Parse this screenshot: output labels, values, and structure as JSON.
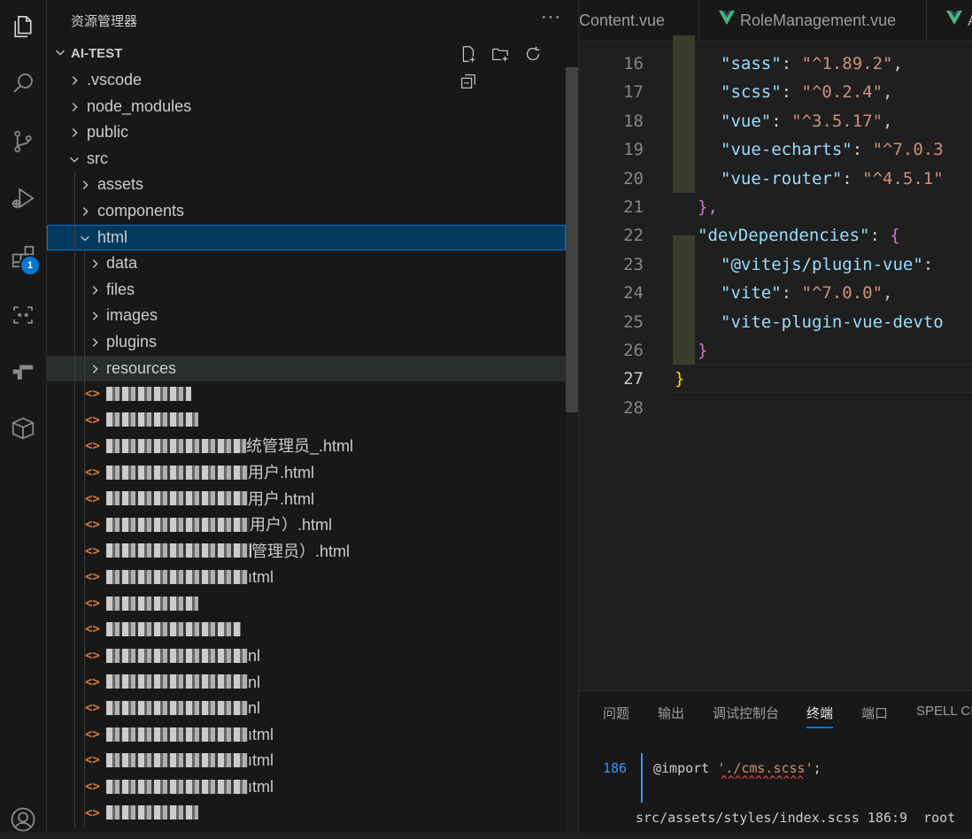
{
  "activity_bar": {
    "icons": [
      "files-icon",
      "search-icon",
      "source-control-icon",
      "run-debug-icon",
      "extensions-icon",
      "copilot-icon",
      "remote-explorer-icon",
      "packages-icon",
      "account-icon"
    ],
    "extensions_badge": "1"
  },
  "sidebar": {
    "title": "资源管理器",
    "more": "···",
    "section_title": "AI-TEST",
    "actions": [
      "new-file-icon",
      "new-folder-icon",
      "refresh-icon",
      "collapse-all-icon"
    ],
    "tree": [
      {
        "label": ".vscode",
        "type": "folder",
        "expanded": false,
        "level": 1
      },
      {
        "label": "node_modules",
        "type": "folder",
        "expanded": false,
        "level": 1
      },
      {
        "label": "public",
        "type": "folder",
        "expanded": false,
        "level": 1
      },
      {
        "label": "src",
        "type": "folder",
        "expanded": true,
        "level": 1
      },
      {
        "label": "assets",
        "type": "folder",
        "expanded": false,
        "level": 2
      },
      {
        "label": "components",
        "type": "folder",
        "expanded": false,
        "level": 2
      },
      {
        "label": "html",
        "type": "folder",
        "expanded": true,
        "level": 2,
        "selected": true
      },
      {
        "label": "data",
        "type": "folder",
        "expanded": false,
        "level": 3
      },
      {
        "label": "files",
        "type": "folder",
        "expanded": false,
        "level": 3
      },
      {
        "label": "images",
        "type": "folder",
        "expanded": false,
        "level": 3
      },
      {
        "label": "plugins",
        "type": "folder",
        "expanded": false,
        "level": 3
      },
      {
        "label": "resources",
        "type": "folder",
        "expanded": false,
        "level": 3,
        "hover": true
      },
      {
        "label": "",
        "type": "html",
        "blur_w": 96
      },
      {
        "label": "",
        "type": "html",
        "blur_w": 104
      },
      {
        "label": "统管理员_.html",
        "type": "html",
        "blur_w": 158
      },
      {
        "label": "用户.html",
        "type": "html",
        "blur_w": 160
      },
      {
        "label": "用户.html",
        "type": "html",
        "blur_w": 160
      },
      {
        "label": "用户）.html",
        "type": "html",
        "blur_w": 162
      },
      {
        "label": "管理员）.html",
        "type": "html",
        "blur_w": 164
      },
      {
        "label": "ıtml",
        "type": "html",
        "blur_w": 160
      },
      {
        "label": "",
        "type": "html",
        "blur_w": 104
      },
      {
        "label": "",
        "type": "html",
        "blur_w": 152
      },
      {
        "label": "nl",
        "type": "html",
        "blur_w": 160
      },
      {
        "label": "nl",
        "type": "html",
        "blur_w": 160
      },
      {
        "label": "nl",
        "type": "html",
        "blur_w": 160
      },
      {
        "label": "ıtml",
        "type": "html",
        "blur_w": 160
      },
      {
        "label": "ıtml",
        "type": "html",
        "blur_w": 160
      },
      {
        "label": "ıtml",
        "type": "html",
        "blur_w": 160
      },
      {
        "label": "",
        "type": "html",
        "blur_w": 104
      }
    ]
  },
  "editor": {
    "tabs": [
      {
        "label": "Content.vue",
        "vue": false
      },
      {
        "label": "RoleManagement.vue",
        "vue": true
      },
      {
        "label": "A",
        "vue": true
      }
    ],
    "lines": [
      {
        "n": "16",
        "key": "\"sass\"",
        "val": "\"^1.89.2\"",
        "tail": ",",
        "indent": 2
      },
      {
        "n": "17",
        "key": "\"scss\"",
        "val": "\"^0.2.4\"",
        "tail": ",",
        "indent": 2
      },
      {
        "n": "18",
        "key": "\"vue\"",
        "val": "\"^3.5.17\"",
        "tail": ",",
        "indent": 2
      },
      {
        "n": "19",
        "key": "\"vue-echarts\"",
        "val": "\"^7.0.3",
        "tail": "",
        "indent": 2
      },
      {
        "n": "20",
        "key": "\"vue-router\"",
        "val": "\"^4.5.1\"",
        "tail": "",
        "indent": 2
      },
      {
        "n": "21",
        "close": "},",
        "indent": 1
      },
      {
        "n": "22",
        "key": "\"devDependencies\"",
        "val": "",
        "tail": "{",
        "indent": 1
      },
      {
        "n": "23",
        "key": "\"@vitejs/plugin-vue\"",
        "val": "",
        "tail": "",
        "indent": 2
      },
      {
        "n": "24",
        "key": "\"vite\"",
        "val": "\"^7.0.0\"",
        "tail": ",",
        "indent": 2
      },
      {
        "n": "25",
        "key": "\"vite-plugin-vue-devto",
        "val": "",
        "tail": "",
        "indent": 2,
        "partial": true
      },
      {
        "n": "26",
        "close": "}",
        "indent": 1
      },
      {
        "n": "27",
        "close": "}",
        "indent": 0,
        "active": true
      },
      {
        "n": "28",
        "close": "",
        "indent": 0
      }
    ]
  },
  "panel": {
    "tabs": [
      "问题",
      "输出",
      "调试控制台",
      "终端",
      "端口",
      "SPELL CI"
    ],
    "active_tab": "终端",
    "terminal": {
      "line_no": "186",
      "code_prefix": "@import ",
      "code_string": "'./cms.scss'",
      "code_suffix": ";",
      "caret": "^^^^^^^^^^^^",
      "location": "src/assets/styles/index.scss 186:9  root"
    }
  }
}
